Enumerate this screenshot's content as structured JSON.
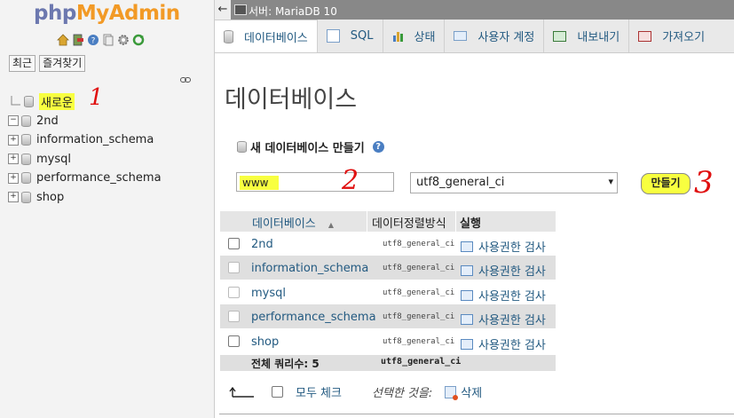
{
  "logo": {
    "part1": "php",
    "part2": "MyAdmin"
  },
  "left_nav": {
    "recent_label": "최근",
    "favorites_label": "즐겨찾기",
    "tree": [
      {
        "label": "새로운",
        "expander": "",
        "highlighted": true
      },
      {
        "label": "2nd",
        "expander": "−"
      },
      {
        "label": "information_schema",
        "expander": "+"
      },
      {
        "label": "mysql",
        "expander": "+"
      },
      {
        "label": "performance_schema",
        "expander": "+"
      },
      {
        "label": "shop",
        "expander": "+"
      }
    ]
  },
  "topbar": {
    "back": "←",
    "server": "서버: MariaDB 10"
  },
  "tabs": [
    {
      "label": "데이터베이스",
      "active": true
    },
    {
      "label": "SQL"
    },
    {
      "label": "상태"
    },
    {
      "label": "사용자 계정"
    },
    {
      "label": "내보내기"
    },
    {
      "label": "가져오기"
    }
  ],
  "page_title": "데이터베이스",
  "create": {
    "title": "새 데이터베이스 만들기",
    "help": "?",
    "db_name_value": "www",
    "collation_value": "utf8_general_ci",
    "button": "만들기"
  },
  "table": {
    "headers": {
      "database": "데이터베이스",
      "sort": "▲",
      "collation": "데이터정렬방식",
      "action": "실행"
    },
    "rows": [
      {
        "name": "2nd",
        "collation": "utf8_general_ci",
        "action": "사용권한 검사",
        "checkbox_enabled": true
      },
      {
        "name": "information_schema",
        "collation": "utf8_general_ci",
        "action": "사용권한 검사",
        "checkbox_enabled": false
      },
      {
        "name": "mysql",
        "collation": "utf8_general_ci",
        "action": "사용권한 검사",
        "checkbox_enabled": false
      },
      {
        "name": "performance_schema",
        "collation": "utf8_general_ci",
        "action": "사용권한 검사",
        "checkbox_enabled": false
      },
      {
        "name": "shop",
        "collation": "utf8_general_ci",
        "action": "사용권한 검사",
        "checkbox_enabled": true
      }
    ],
    "total_label": "전체 쿼리수: 5",
    "total_collation": "utf8_general_ci"
  },
  "bottom": {
    "arrow": "⮤",
    "check_all": "모두 체크",
    "with_selected": "선택한 것을:",
    "delete": "삭제"
  },
  "annotations": {
    "one": "1",
    "two": "2",
    "three": "3"
  },
  "colors": {
    "highlight": "#f8ff40",
    "link": "#235a81",
    "annotation": "#e01010"
  }
}
